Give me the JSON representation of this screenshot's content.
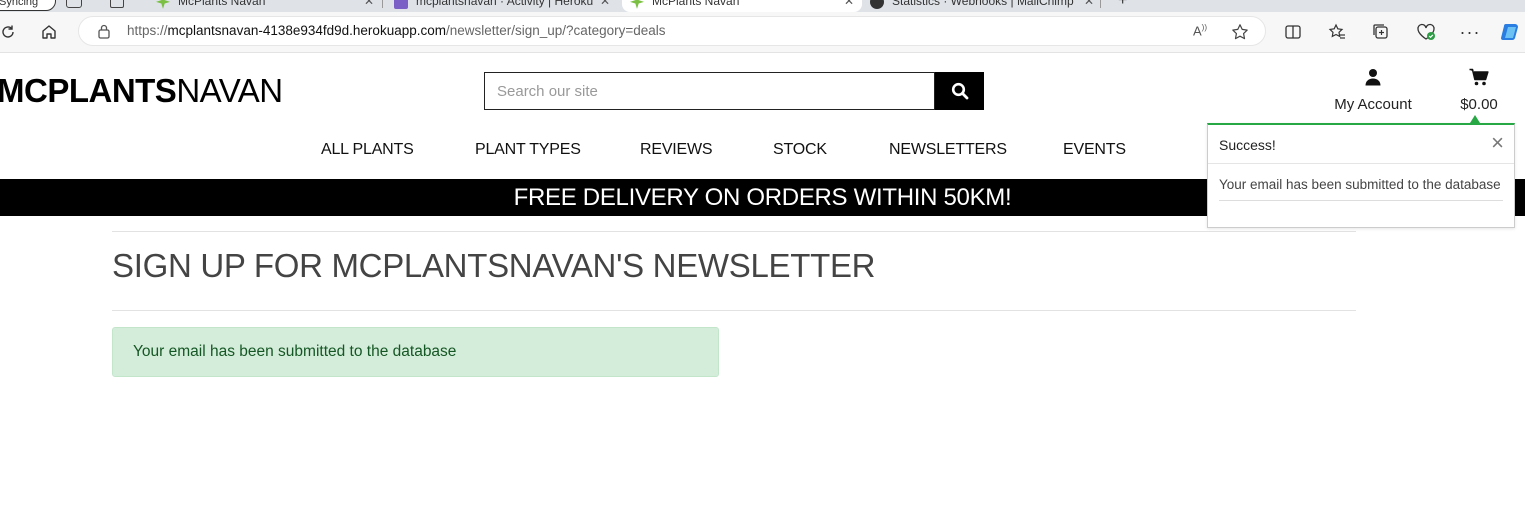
{
  "browser": {
    "tabs": [
      {
        "label": "Syncing"
      },
      {
        "label": "McPlants Navan"
      },
      {
        "label": "mcplantsnavan · Activity | Heroku"
      },
      {
        "label": "McPlants Navan"
      },
      {
        "label": "Statistics · Webhooks | MailChimp"
      }
    ],
    "url_scheme": "https://",
    "url_host": "mcplantsnavan-4138e934fd9d.herokuapp.com",
    "url_path": "/newsletter/sign_up/?category=deals"
  },
  "site": {
    "logo_bold": "MCPLANTS",
    "logo_light": "NAVAN",
    "search_placeholder": "Search our site",
    "account_label": "My Account",
    "bag_total": "$0.00",
    "nav": [
      "ALL PLANTS",
      "PLANT TYPES",
      "REVIEWS",
      "STOCK",
      "NEWSLETTERS",
      "EVENTS"
    ],
    "banner": "FREE DELIVERY ON ORDERS WITHIN 50KM!"
  },
  "main": {
    "title": "SIGN UP FOR MCPLANTSNAVAN'S NEWSLETTER",
    "alert": "Your email has been submitted to the database"
  },
  "toast": {
    "title": "Success!",
    "close": "×",
    "message": "Your email has been submitted to the database"
  },
  "colors": {
    "toast_accent": "#28a745",
    "alert_bg": "#d4edda",
    "alert_text": "#155724",
    "banner_bg": "#000000"
  }
}
